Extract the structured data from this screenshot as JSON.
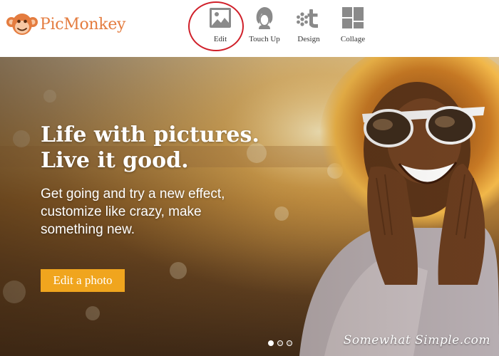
{
  "header": {
    "logo_text": "PicMonkey",
    "logo_icon": "monkey-face-icon",
    "brand_color": "#e47c3f",
    "nav": [
      {
        "label": "Edit",
        "icon": "image-icon",
        "highlighted": true
      },
      {
        "label": "Touch Up",
        "icon": "face-silhouette-icon"
      },
      {
        "label": "Design",
        "icon": "design-t-icon"
      },
      {
        "label": "Collage",
        "icon": "collage-grid-icon"
      }
    ]
  },
  "hero": {
    "title": "Life with pictures.\nLive it good.",
    "subtitle": "Get going and try a new effect,\ncustomize like crazy, make\nsomething new.",
    "cta_label": "Edit a photo",
    "cta_color": "#f0a51e",
    "carousel": {
      "count": 3,
      "active": 1
    }
  },
  "watermark": "Somewhat Simple.com",
  "colors": {
    "highlight_ring": "#d0202a",
    "icon_gray": "#8a8a8a"
  }
}
